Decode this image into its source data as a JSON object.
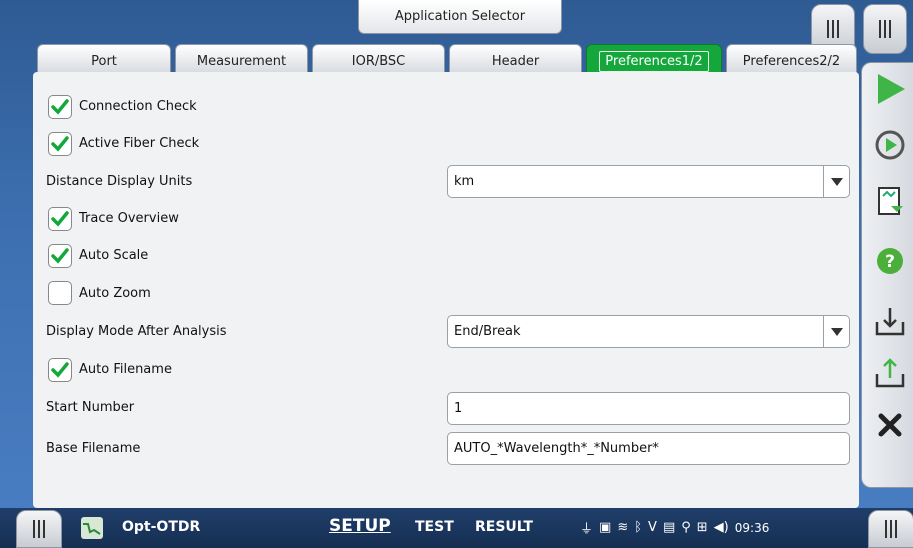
{
  "header": {
    "title": "Application Selector"
  },
  "tabs": [
    {
      "label": "Port",
      "active": false
    },
    {
      "label": "Measurement",
      "active": false
    },
    {
      "label": "IOR/BSC",
      "active": false
    },
    {
      "label": "Header",
      "active": false
    },
    {
      "label": "Preferences1/2",
      "active": true
    },
    {
      "label": "Preferences2/2",
      "active": false
    }
  ],
  "form": {
    "connection_check": {
      "label": "Connection Check",
      "checked": true
    },
    "active_fiber_check": {
      "label": "Active Fiber Check",
      "checked": true
    },
    "distance_units": {
      "label": "Distance Display Units",
      "value": "km"
    },
    "trace_overview": {
      "label": "Trace Overview",
      "checked": true
    },
    "auto_scale": {
      "label": "Auto Scale",
      "checked": true
    },
    "auto_zoom": {
      "label": "Auto Zoom",
      "checked": false
    },
    "display_mode": {
      "label": "Display Mode After Analysis",
      "value": "End/Break"
    },
    "auto_filename": {
      "label": "Auto Filename",
      "checked": true
    },
    "start_number": {
      "label": "Start Number",
      "value": "1"
    },
    "base_filename": {
      "label": "Base Filename",
      "value": "AUTO_*Wavelength*_*Number*"
    }
  },
  "sidebar": {
    "icons": [
      "play-icon",
      "repeat-play-icon",
      "report-icon",
      "help-icon",
      "load-icon",
      "save-icon",
      "close-icon"
    ]
  },
  "bottom": {
    "app_name": "Opt-OTDR",
    "nav": {
      "setup": "SETUP",
      "test": "TEST",
      "result": "RESULT"
    },
    "time": "09:36"
  },
  "colors": {
    "accent_green": "#14a83c",
    "background_blue": "#3d6fb0"
  }
}
